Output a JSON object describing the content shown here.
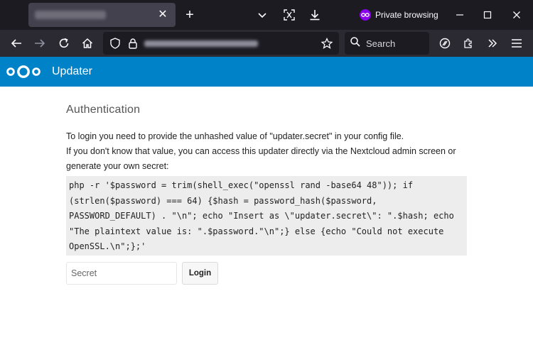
{
  "browser": {
    "tab": {
      "close_glyph": "✕"
    },
    "new_tab_glyph": "+",
    "private_label": "Private browsing",
    "search_label": "Search",
    "icons": [
      "back-icon",
      "forward-icon",
      "reload-icon",
      "home-icon",
      "shield-icon",
      "lock-icon",
      "star-icon",
      "search-icon",
      "extension-icon",
      "puzzle-icon",
      "overflow-icon",
      "menu-icon",
      "list-all-tabs-icon",
      "screenshot-icon",
      "download-icon",
      "minimize-icon",
      "maximize-icon",
      "close-window-icon"
    ],
    "colors": {
      "tabstrip": "#1c1b22",
      "navbar": "#2b2a33",
      "private": "#8a00ea"
    }
  },
  "header": {
    "title": "Updater",
    "color": "#0082c9"
  },
  "main": {
    "heading": "Authentication",
    "para1": "To login you need to provide the unhashed value of \"updater.secret\" in your config file.",
    "para2": "If you don't know that value, you can access this updater directly via the Nextcloud admin screen or generate your own secret:",
    "code": "php -r '$password = trim(shell_exec(\"openssl rand -base64 48\")); if (strlen($password) === 64) {$hash = password_hash($password, PASSWORD_DEFAULT) . \"\\n\"; echo \"Insert as \\\"updater.secret\\\": \".$hash; echo \"The plaintext value is: \".$password.\"\\n\";} else {echo \"Could not execute OpenSSL.\\n\";};'",
    "secret_placeholder": "Secret",
    "login_label": "Login"
  }
}
